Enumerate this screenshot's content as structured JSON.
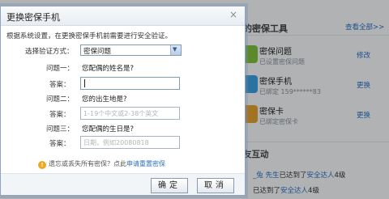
{
  "background": {
    "section_title": "的密保工具",
    "more_link": "查看全部>>",
    "tools": [
      {
        "name": "密保问题",
        "status": "已设置密保问题",
        "action": "修改",
        "color": "#7fbf3f"
      },
      {
        "name": "密保手机",
        "status": "已绑定 159******83",
        "action": "更换",
        "color": "#3a9ee0"
      },
      {
        "name": "密保卡",
        "status": "已绑定密保卡",
        "action": "更换",
        "color": "#e0a030"
      }
    ],
    "section2_title": "友互动",
    "activities": [
      {
        "user": "_兔 先生",
        "mid": "已达到了",
        "badge": "安全达人",
        "tail": "4级"
      },
      {
        "user": "",
        "mid": "已达到了",
        "badge": "安全达人",
        "tail": "4级"
      }
    ]
  },
  "dialog": {
    "title": "更换密保手机",
    "close": "×",
    "intro": "根据系统设置，在更换密保手机前需要进行安全验证。",
    "method_label": "选择验证方式：",
    "method_value": "密保问题",
    "questions": [
      {
        "label": "问题一：",
        "question": "您配偶的姓名是?",
        "answer_label": "答案：",
        "placeholder": ""
      },
      {
        "label": "问题二：",
        "question": "您的出生地是?",
        "answer_label": "答案：",
        "placeholder": "1-19个中文或2-38个英文"
      },
      {
        "label": "问题三：",
        "question": "您配偶的生日是?",
        "answer_label": "答案：",
        "placeholder": "日期，例如20080818"
      }
    ],
    "hint_text": "遗忘或丢失所有密保？点此",
    "hint_link": "申请重置密保",
    "confirm": "确定",
    "cancel": "取消"
  }
}
